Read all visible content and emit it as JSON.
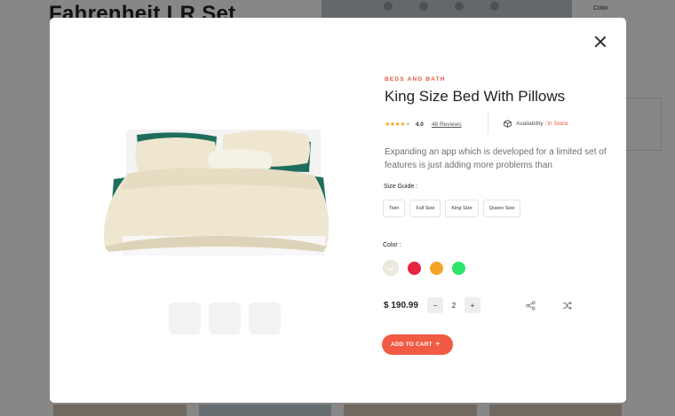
{
  "background": {
    "title": "Fahrenheit LR Set",
    "color_label": "Color"
  },
  "modal": {
    "category": "BEDS AND BATH",
    "title": "King Size Bed With Pillows",
    "rating": {
      "stars": 4,
      "max": 5,
      "value": "4.0",
      "reviews": "48 Reviews"
    },
    "availability": {
      "label": "Availability :",
      "status": "In Stock"
    },
    "description": "Expanding an app which is developed for a limited set of features is just adding more problems than",
    "size_guide": {
      "label": "Size Guide :",
      "options": [
        "Twin",
        "Full Size",
        "King Size",
        "Queen Size"
      ]
    },
    "color": {
      "label": "Color :",
      "options": [
        "#efe9dd",
        "#e8253f",
        "#f5a325",
        "#2fe36a"
      ],
      "selected_index": 0
    },
    "price": "$ 190.99",
    "quantity": {
      "minus": "−",
      "value": "2",
      "plus": "+"
    },
    "add_to_cart": {
      "label": "ADD TO CART",
      "icon": "+"
    },
    "icons": {
      "close": "close-icon",
      "share": "share-icon",
      "compare": "shuffle-icon",
      "availability": "box-icon"
    },
    "accent_color": "#f15a43"
  }
}
